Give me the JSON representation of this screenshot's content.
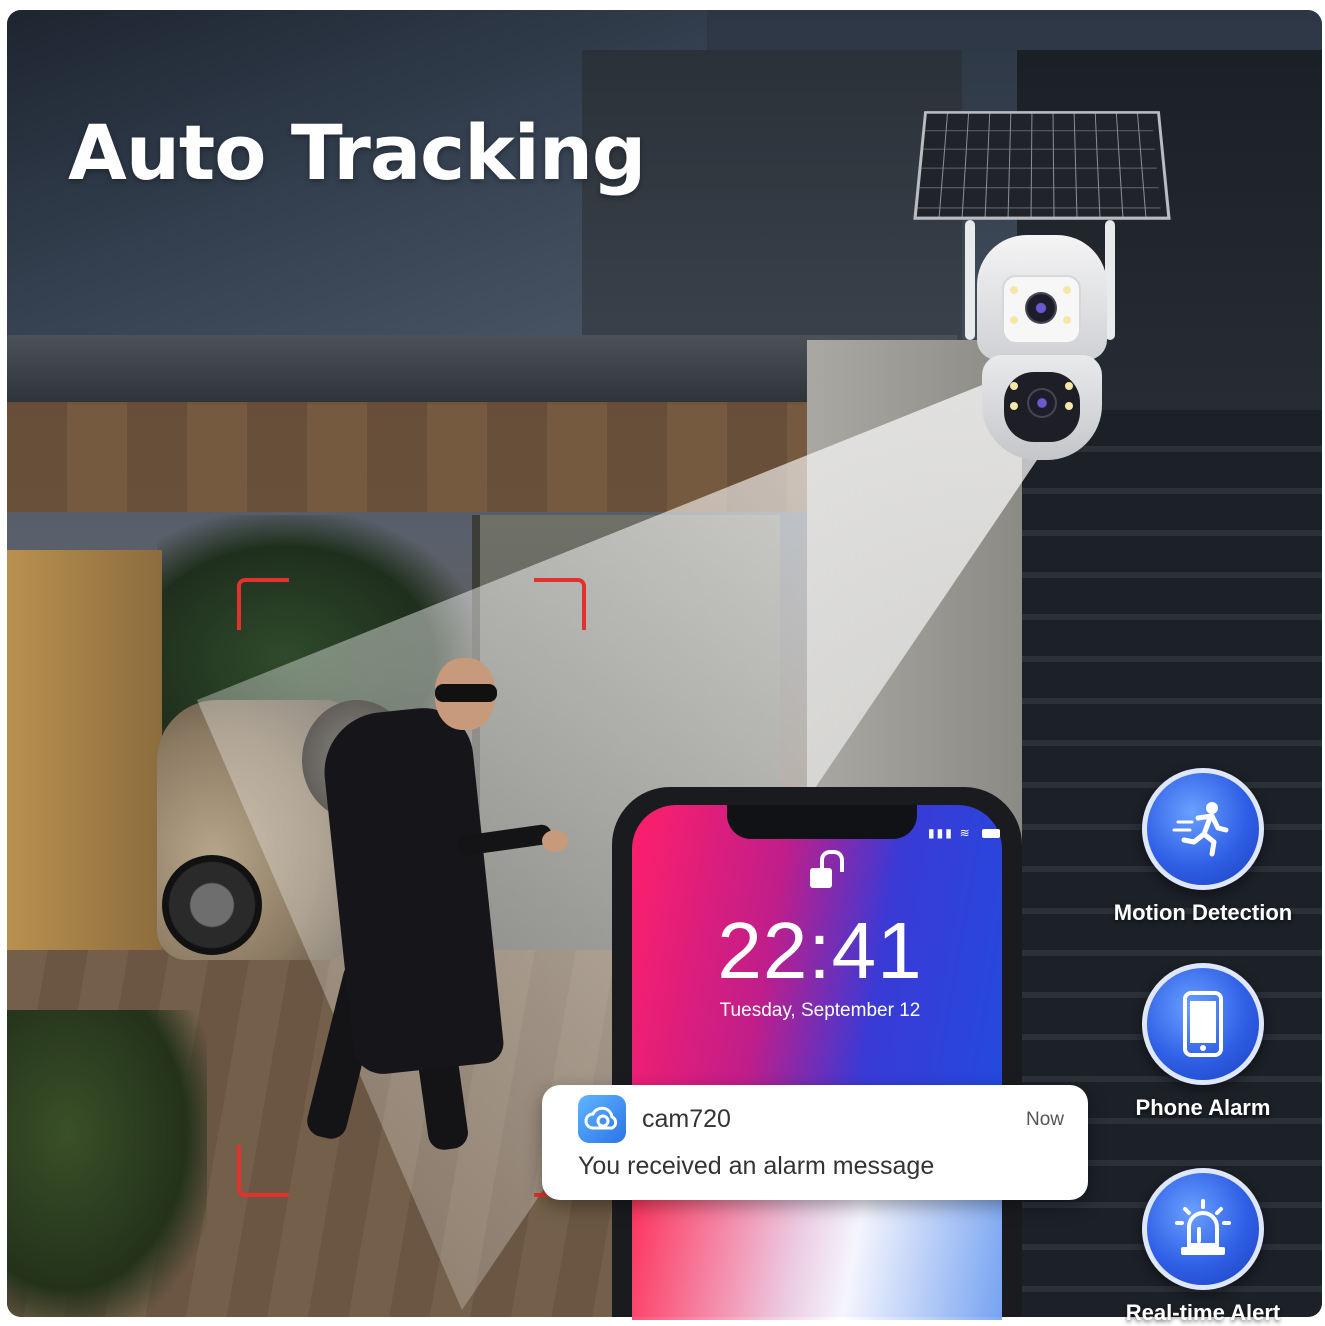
{
  "headline": "Auto Tracking",
  "phone": {
    "time": "22:41",
    "date": "Tuesday, September 12"
  },
  "notification": {
    "app_name": "cam720",
    "time": "Now",
    "message": "You received an alarm message"
  },
  "features": [
    {
      "label": "Motion Detection",
      "icon": "running-person-icon"
    },
    {
      "label": "Phone Alarm",
      "icon": "smartphone-icon"
    },
    {
      "label": "Real-time Alert",
      "icon": "alarm-siren-icon"
    }
  ],
  "colors": {
    "tracking_frame": "#e3312d",
    "badge_blue": "#2f5fe6",
    "headline": "#ffffff"
  }
}
